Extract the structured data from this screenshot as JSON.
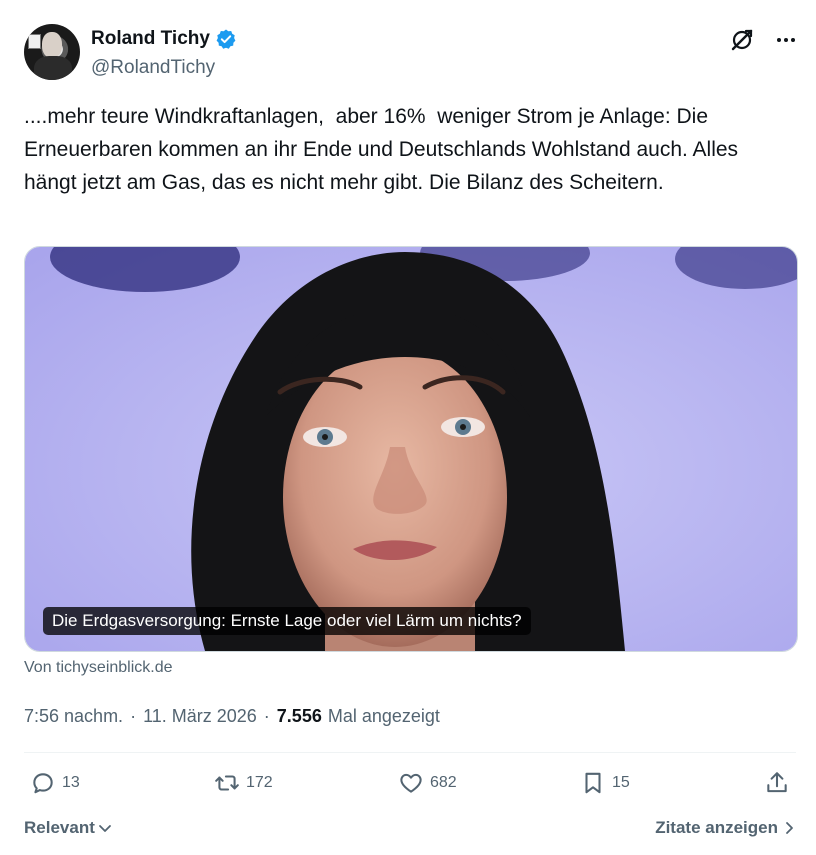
{
  "author": {
    "display_name": "Roland Tichy",
    "handle": "@RolandTichy",
    "verified_color": "#1d9bf0"
  },
  "header_icons": [
    "grok-icon",
    "more-icon"
  ],
  "tweet": {
    "text": "....mehr teure Windkraftanlagen,  aber 16%  weniger Strom je Anlage: Die Erneuerbaren kommen an ihr Ende und Deutschlands Wohlstand auch. Alles hängt jetzt am Gas, das es nicht mehr gibt. Die Bilanz des Scheitern."
  },
  "card": {
    "caption": "Die Erdgasversorgung: Ernste Lage oder viel Lärm um nichts?",
    "source": "Von tichyseinblick.de"
  },
  "meta": {
    "time": "7:56 nachm.",
    "separator": "·",
    "date": "11. März 2026",
    "views_count": "7.556",
    "views_label": "Mal angezeigt"
  },
  "actions": {
    "replies": "13",
    "reposts": "172",
    "likes": "682",
    "bookmarks": "15"
  },
  "footer": {
    "sort_label": "Relevant",
    "quotes_label": "Zitate anzeigen"
  },
  "colors": {
    "text_primary": "#0f1419",
    "text_secondary": "#536471",
    "accent": "#1d9bf0",
    "card_background": "#b9b6f2"
  }
}
